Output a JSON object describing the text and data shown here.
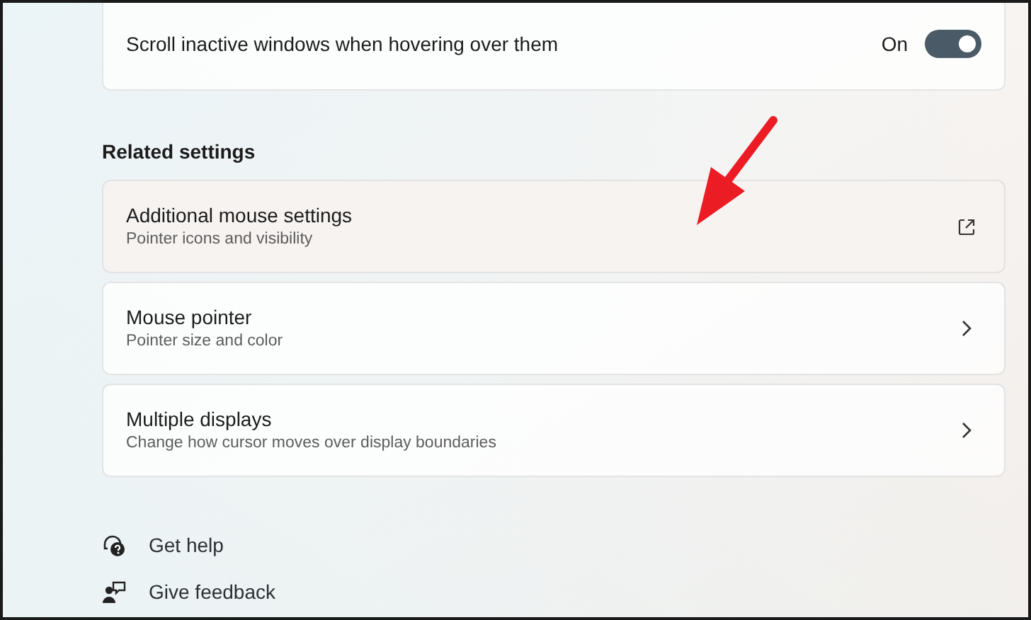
{
  "toggle_row": {
    "label": "Scroll inactive windows when hovering over them",
    "state_text": "On",
    "on": true
  },
  "related_settings": {
    "heading": "Related settings",
    "items": [
      {
        "title": "Additional mouse settings",
        "subtitle": "Pointer icons and visibility",
        "kind": "external"
      },
      {
        "title": "Mouse pointer",
        "subtitle": "Pointer size and color",
        "kind": "chevron"
      },
      {
        "title": "Multiple displays",
        "subtitle": "Change how cursor moves over display boundaries",
        "kind": "chevron"
      }
    ]
  },
  "help_links": [
    {
      "label": "Get help",
      "kind": "help"
    },
    {
      "label": "Give feedback",
      "kind": "feedback"
    }
  ]
}
